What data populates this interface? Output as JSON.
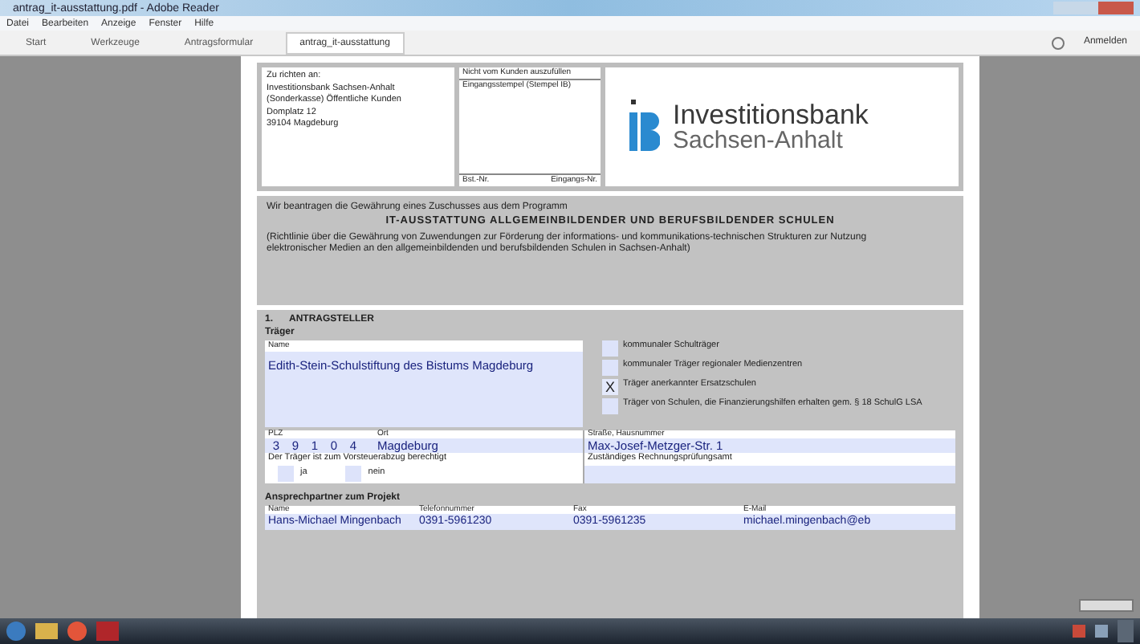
{
  "window": {
    "title": "antrag_it-ausstattung.pdf - Adobe Reader"
  },
  "menu": [
    "Datei",
    "Bearbeiten",
    "Anzeige",
    "Fenster",
    "Hilfe"
  ],
  "tabs": [
    {
      "label": "Start",
      "selected": false
    },
    {
      "label": "Werkzeuge",
      "selected": false
    },
    {
      "label": "Antragsformular",
      "selected": false
    },
    {
      "label": "antrag_it-ausstattung",
      "selected": true
    }
  ],
  "sign_in": "Anmelden",
  "form": {
    "address_lines": [
      "Zu richten an:",
      "Investitionsbank Sachsen-Anhalt",
      "(Sonderkasse) Öffentliche Kunden",
      "Domplatz 12",
      "39104 Magdeburg"
    ],
    "office_box": {
      "title": "Nicht vom Kunden auszufüllen",
      "stamp": "Eingangsstempel (Stempel IB)",
      "left_footer": "Bst.-Nr.",
      "right_footer": "Eingangs-Nr."
    },
    "logo": {
      "line_1": "Investitionsbank",
      "line_2": "Sachsen-Anhalt"
    },
    "intro": "Wir beantragen die Gewährung eines Zuschusses aus dem Programm",
    "program": "IT-AUSSTATTUNG ALLGEMEINBILDENDER UND BERUFSBILDENDER SCHULEN",
    "guideline": "(Richtlinie über die Gewährung von Zuwendungen zur Förderung der informations- und kommunikations-technischen Strukturen zur Nutzung elektronischer Medien an den allgemeinbildenden und berufsbildenden Schulen in Sachsen-Anhalt)",
    "section_number": "1.",
    "section_title": "ANTRAGSTELLER",
    "carrier_heading": "Träger",
    "name_label": "Name",
    "name_value": "Edith-Stein-Schulstiftung des Bistums Magdeburg",
    "carrier_types": [
      {
        "label": "kommunaler Schulträger",
        "checked": false
      },
      {
        "label": "kommunaler Träger regionaler Medienzentren",
        "checked": false
      },
      {
        "label": "Träger anerkannter Ersatzschulen",
        "checked": true
      },
      {
        "label": "Träger von Schulen, die Finanzierungshilfen erhalten gem. § 18 SchulG LSA",
        "checked": false
      }
    ],
    "check_mark": "X",
    "zip_label": "PLZ",
    "zip_digits": [
      "3",
      "9",
      "1",
      "0",
      "4"
    ],
    "city_label": "Ort",
    "city_value": "Magdeburg",
    "street_label": "Straße, Hausnummer",
    "street_value": "Max-Josef-Metzger-Str. 1",
    "tax_question": "Der Träger ist zum Vorsteuerabzug berechtigt",
    "tax_options": [
      {
        "label": "ja",
        "checked": false
      },
      {
        "label": "nein",
        "checked": false
      }
    ],
    "audit_label": "Zuständiges Rechnungsprüfungsamt",
    "contact_heading": "Ansprechpartner zum Projekt",
    "contact": [
      {
        "label": "Name",
        "value": "Hans-Michael Mingenbach"
      },
      {
        "label": "Telefonnummer",
        "value": "0391-5961230"
      },
      {
        "label": "Fax",
        "value": "0391-5961235"
      },
      {
        "label": "E-Mail",
        "value": "michael.mingenbach@eb"
      }
    ]
  }
}
